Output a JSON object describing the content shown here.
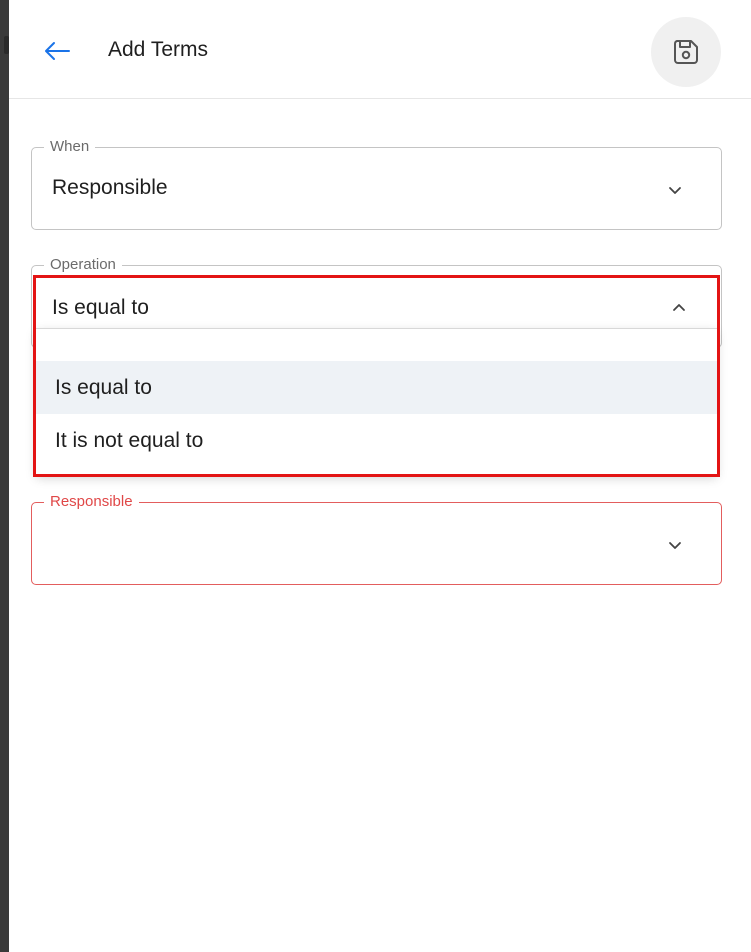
{
  "header": {
    "title": "Add Terms",
    "back_icon": "arrow-left-icon",
    "save_icon": "floppy-disk-icon",
    "accent_color": "#1a73e8"
  },
  "fields": {
    "when": {
      "label": "When",
      "value": "Responsible"
    },
    "operation": {
      "label": "Operation",
      "value": "Is equal to",
      "expanded": true
    },
    "responsible": {
      "label": "Responsible",
      "value": "",
      "error_color": "#e04848"
    }
  },
  "operation_menu": {
    "options": [
      {
        "label": "Is equal to",
        "selected": true
      },
      {
        "label": "It is not equal to",
        "selected": false
      }
    ]
  },
  "highlight_color": "#e31414"
}
